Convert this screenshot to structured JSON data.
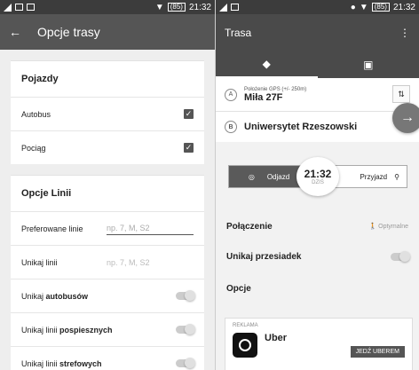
{
  "left": {
    "status": {
      "time": "21:32",
      "battery": "(85)"
    },
    "title": "Opcje trasy",
    "vehicles": {
      "heading": "Pojazdy",
      "items": [
        {
          "label": "Autobus",
          "checked": "✓"
        },
        {
          "label": "Pociąg",
          "checked": "✓"
        }
      ]
    },
    "lines": {
      "heading": "Opcje Linii",
      "preferred_label": "Preferowane linie",
      "preferred_placeholder": "np. 7, M, S2",
      "avoid_label": "Unikaj linii",
      "avoid_placeholder": "np. 7, M, S2",
      "toggles": [
        {
          "prefix": "Unikaj ",
          "bold": "autobusów"
        },
        {
          "prefix": "Unikaj linii ",
          "bold": "pospiesznych"
        },
        {
          "prefix": "Unikaj linii ",
          "bold": "strefowych"
        }
      ]
    }
  },
  "right": {
    "status": {
      "time": "21:32",
      "battery": "(85)"
    },
    "title": "Trasa",
    "from_letter": "A",
    "from_hint": "Położenie GPS (+/- 250m)",
    "from": "Miła 27F",
    "to_letter": "B",
    "to": "Uniwersytet Rzeszowski",
    "depart": "Odjazd",
    "arrive": "Przyjazd",
    "time": "21:32",
    "day": "DZIŚ",
    "connection": "Połączenie",
    "optimal": "Optymalne",
    "avoid_transfers": "Unikaj przesiadek",
    "options": "Opcje",
    "ad_label": "REKLAMA",
    "ad_brand": "Uber",
    "ad_button": "JEDŹ UBEREM"
  }
}
